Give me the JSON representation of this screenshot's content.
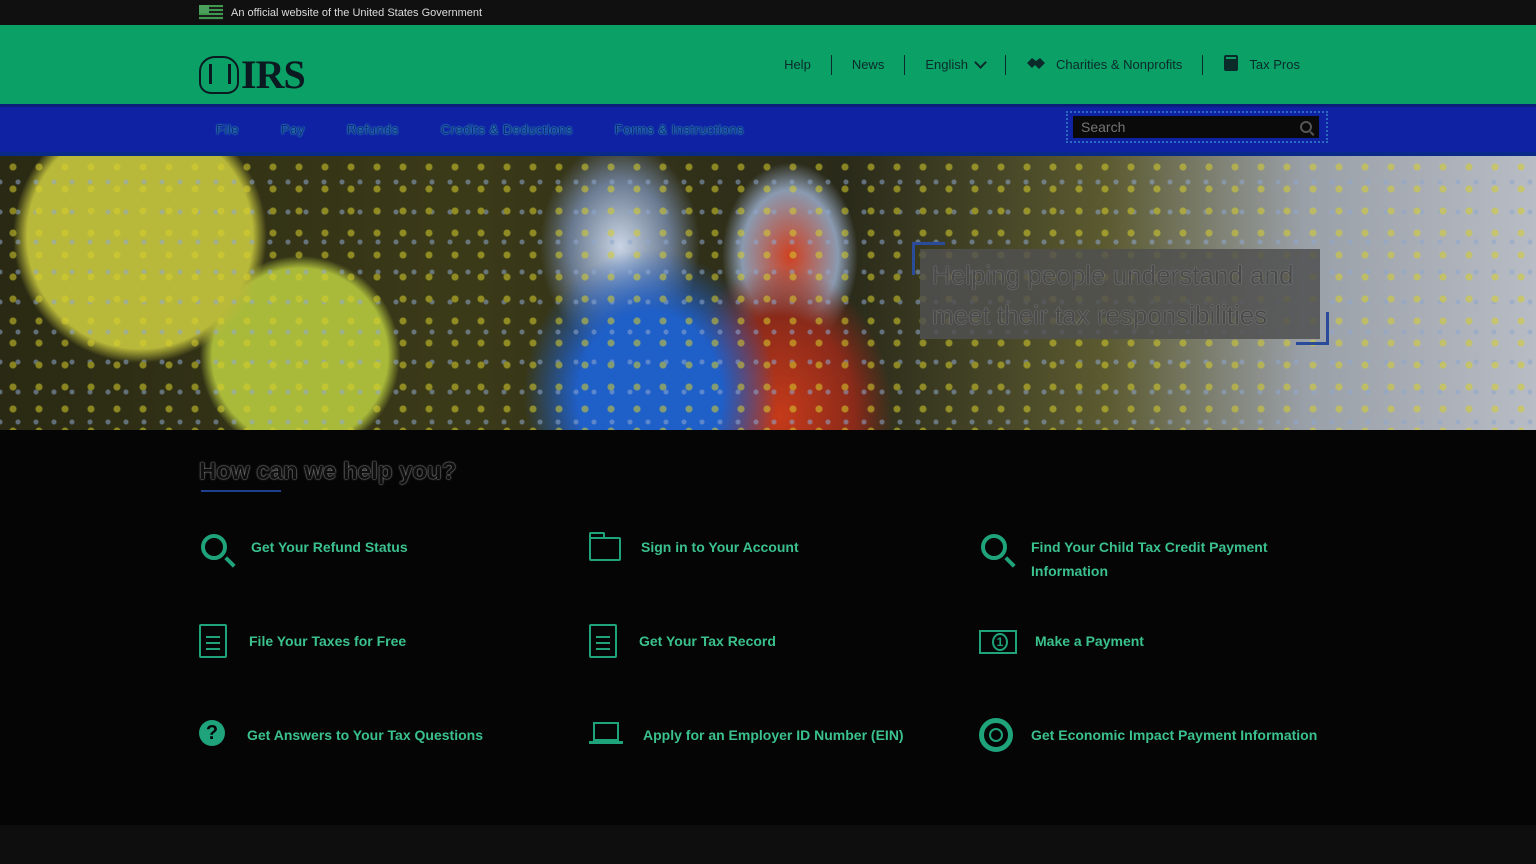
{
  "gov_banner": {
    "text": "An official website of the United States Government"
  },
  "header": {
    "logo_text": "IRS",
    "utility_nav": [
      {
        "label": "Help"
      },
      {
        "label": "News"
      },
      {
        "label": "English"
      },
      {
        "label": "Charities & Nonprofits",
        "icon": "handshake-icon"
      },
      {
        "label": "Tax Pros",
        "icon": "book-icon"
      }
    ]
  },
  "main_nav": {
    "items": [
      "File",
      "Pay",
      "Refunds",
      "Credits & Deductions",
      "Forms & Instructions"
    ],
    "search_placeholder": "Search"
  },
  "hero": {
    "caption": "Helping people understand and meet their tax responsibilities"
  },
  "help": {
    "heading": "How can we help you?",
    "links": [
      {
        "label": "Get Your Refund Status",
        "icon": "search-icon"
      },
      {
        "label": "Sign in to Your Account",
        "icon": "folder-icon"
      },
      {
        "label": "Find Your Child Tax Credit Payment Information",
        "icon": "search-icon"
      },
      {
        "label": "File Your Taxes for Free",
        "icon": "document-icon"
      },
      {
        "label": "Get Your Tax Record",
        "icon": "document-icon"
      },
      {
        "label": "Make a Payment",
        "icon": "money-icon"
      },
      {
        "label": "Get Answers to Your Tax Questions",
        "icon": "question-icon"
      },
      {
        "label": "Apply for an Employer ID Number (EIN)",
        "icon": "laptop-icon"
      },
      {
        "label": "Get Economic Impact Payment Information",
        "icon": "lifebuoy-icon"
      }
    ]
  },
  "colors": {
    "header_green": "#0aa066",
    "nav_blue": "#0e22a3",
    "link_green": "#3ac18d"
  }
}
